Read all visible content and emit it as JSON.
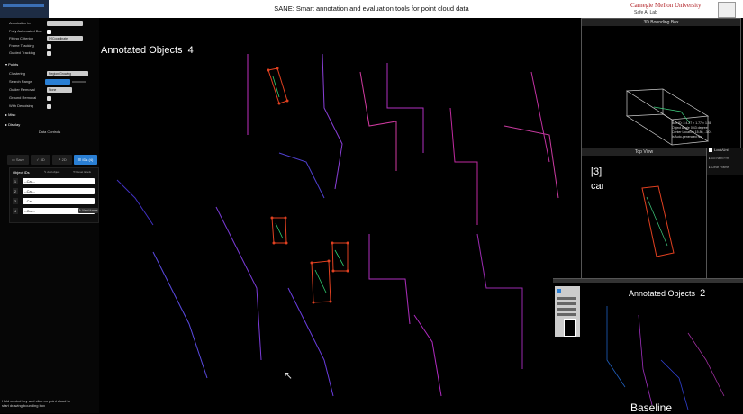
{
  "header": {
    "title": "SANE: Smart annotation and evaluation tools for point cloud data",
    "university": "Carnegie Mellon University",
    "lab": "Safe AI Lab"
  },
  "panel": {
    "annotation_label": "Annotation to",
    "fully_auto_label": "Fully Automated Box",
    "fitting_label": "Fitting Criterion",
    "fitting_value": "[+]Coordinate",
    "frame_tracking_label": "Frame Tracking",
    "guided_tracking_label": "Guided Tracking",
    "points_section": "Points",
    "clustering_label": "Clustering",
    "clustering_value": "Region Growing",
    "search_range_label": "Search Range",
    "outlier_label": "Outlier Removal",
    "outlier_value": "None",
    "ground_label": "Ground Removal",
    "with_denoising_label": "With Denoising",
    "misc_section": "Misc",
    "display_section": "Display",
    "data_controls": "Data Controls",
    "tabs": [
      "Save",
      "3D",
      "2D",
      "IDs (4)"
    ],
    "object_ids_label": "Object IDs",
    "add_object_label": "Add object",
    "reset_label": "Reset labels",
    "objects": [
      {
        "id": "1",
        "class": "--Car--"
      },
      {
        "id": "2",
        "class": "--Car--"
      },
      {
        "id": "3",
        "class": "--Car--"
      },
      {
        "id": "4",
        "class": "--Car--"
      }
    ],
    "next_frame_label": "Next frame",
    "hint": "Hold control key and click on point cloud to start drawing bounding box"
  },
  "main": {
    "annotated_label": "Annotated Objects",
    "annotated_count": "4"
  },
  "view3d": {
    "title": "3D Bounding Box",
    "info_rows": [
      [
        "Box ID: 3",
        "4.27 × 1.77 × 1.58"
      ],
      [
        "Object Angle",
        "0.43 degree"
      ],
      [
        "Center Location",
        "15.86, -3.01"
      ],
      [
        "Is Auto-generated",
        "No"
      ]
    ]
  },
  "topview": {
    "title": "Top View",
    "lock_label": "Lock/Unl",
    "btn1": "Go Next Frm",
    "btn2": "Clear Frame",
    "object_id": "[3]",
    "object_class": "car"
  },
  "baseline": {
    "annotated_label": "Annotated Objects",
    "annotated_count": "2",
    "name": "Baseline"
  }
}
